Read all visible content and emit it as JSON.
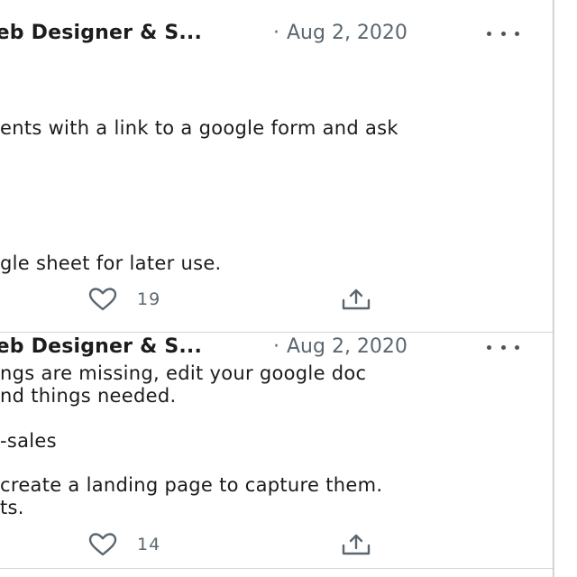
{
  "tweets": [
    {
      "author": "Web Designer & S...",
      "date": "Aug 2, 2020",
      "lines": [
        "ents with a link to a google form and ask",
        "gle sheet for later use."
      ],
      "like_count": "19"
    },
    {
      "author": "Web Designer & S...",
      "date": "Aug 2, 2020",
      "lines": [
        "ngs are missing, edit your google doc",
        "nd things needed.",
        "-sales",
        "create a landing page to capture them.",
        "ts."
      ],
      "like_count": "14"
    }
  ],
  "icons": {
    "like": "heart-icon",
    "share": "share-icon",
    "more": "more-icon"
  },
  "colors": {
    "meta_text": "#5b6770",
    "body_text": "#1b1b1b",
    "divider": "#d6d6d6"
  }
}
